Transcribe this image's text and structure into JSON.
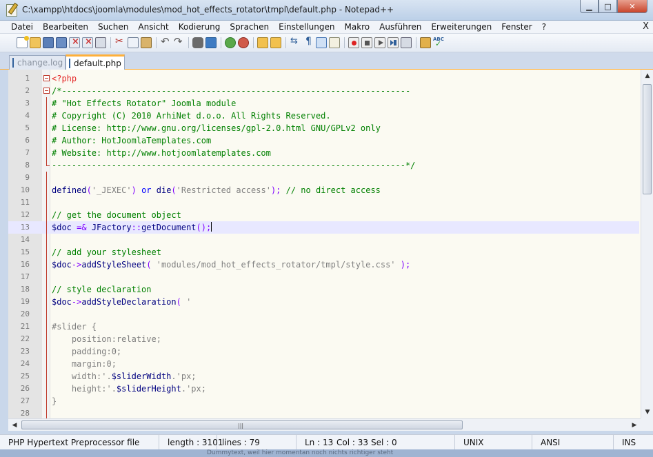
{
  "window": {
    "title": "C:\\xampp\\htdocs\\joomla\\modules\\mod_hot_effects_rotator\\tmpl\\default.php - Notepad++",
    "buttons": {
      "minimize": "▁",
      "maximize": "□",
      "close": "✕"
    }
  },
  "menu": {
    "items": [
      "Datei",
      "Bearbeiten",
      "Suchen",
      "Ansicht",
      "Kodierung",
      "Sprachen",
      "Einstellungen",
      "Makro",
      "Ausführen",
      "Erweiterungen",
      "Fenster",
      "?"
    ],
    "close_label": "X"
  },
  "tabs": [
    {
      "label": "change.log",
      "active": false
    },
    {
      "label": "default.php",
      "active": true
    }
  ],
  "editor": {
    "current_line": 13,
    "lines": [
      {
        "n": "1",
        "fold": "box",
        "segments": [
          {
            "t": "<?php",
            "c": "#e32727"
          }
        ]
      },
      {
        "n": "2",
        "fold": "box",
        "segments": [
          {
            "t": "/*----------------------------------------------------------------------",
            "c": "#008000"
          }
        ]
      },
      {
        "n": "3",
        "fold": "vline",
        "segments": [
          {
            "t": "# \"Hot Effects Rotator\" Joomla module",
            "c": "#008000"
          }
        ]
      },
      {
        "n": "4",
        "fold": "vline",
        "segments": [
          {
            "t": "# Copyright (C) 2010 ArhiNet d.o.o. All Rights Reserved.",
            "c": "#008000"
          }
        ]
      },
      {
        "n": "5",
        "fold": "vline",
        "segments": [
          {
            "t": "# License: http://www.gnu.org/licenses/gpl-2.0.html GNU/GPLv2 only",
            "c": "#008000"
          }
        ]
      },
      {
        "n": "6",
        "fold": "vline",
        "segments": [
          {
            "t": "# Author: HotJoomlaTemplates.com",
            "c": "#008000"
          }
        ]
      },
      {
        "n": "7",
        "fold": "vline",
        "segments": [
          {
            "t": "# Website: http://www.hotjoomlatemplates.com",
            "c": "#008000"
          }
        ]
      },
      {
        "n": "8",
        "fold": "end",
        "segments": [
          {
            "t": "-----------------------------------------------------------------------*/",
            "c": "#008000"
          }
        ]
      },
      {
        "n": "9",
        "fold": "vline",
        "segments": []
      },
      {
        "n": "10",
        "fold": "vline",
        "segments": [
          {
            "t": "defined",
            "c": "#000080"
          },
          {
            "t": "(",
            "c": "#8000ff"
          },
          {
            "t": "'_JEXEC'",
            "c": "#808080"
          },
          {
            "t": ") ",
            "c": "#8000ff"
          },
          {
            "t": "or",
            "c": "#0000ff"
          },
          {
            "t": " die",
            "c": "#000080"
          },
          {
            "t": "(",
            "c": "#8000ff"
          },
          {
            "t": "'Restricted access'",
            "c": "#808080"
          },
          {
            "t": "); ",
            "c": "#8000ff"
          },
          {
            "t": "// no direct access",
            "c": "#008000"
          }
        ]
      },
      {
        "n": "11",
        "fold": "vline",
        "segments": []
      },
      {
        "n": "12",
        "fold": "vline",
        "segments": [
          {
            "t": "// get the document object",
            "c": "#008000"
          }
        ]
      },
      {
        "n": "13",
        "fold": "vline",
        "segments": [
          {
            "t": "$doc",
            "c": "#000080"
          },
          {
            "t": " =& ",
            "c": "#8000ff"
          },
          {
            "t": "JFactory",
            "c": "#000080"
          },
          {
            "t": "::",
            "c": "#8000ff"
          },
          {
            "t": "getDocument",
            "c": "#000080"
          },
          {
            "t": "();",
            "c": "#8000ff"
          }
        ]
      },
      {
        "n": "14",
        "fold": "vline",
        "segments": []
      },
      {
        "n": "15",
        "fold": "vline",
        "segments": [
          {
            "t": "// add your stylesheet",
            "c": "#008000"
          }
        ]
      },
      {
        "n": "16",
        "fold": "vline",
        "segments": [
          {
            "t": "$doc",
            "c": "#000080"
          },
          {
            "t": "->",
            "c": "#8000ff"
          },
          {
            "t": "addStyleSheet",
            "c": "#000080"
          },
          {
            "t": "( ",
            "c": "#8000ff"
          },
          {
            "t": "'modules/mod_hot_effects_rotator/tmpl/style.css'",
            "c": "#808080"
          },
          {
            "t": " );",
            "c": "#8000ff"
          }
        ]
      },
      {
        "n": "17",
        "fold": "vline",
        "segments": []
      },
      {
        "n": "18",
        "fold": "vline",
        "segments": [
          {
            "t": "// style declaration",
            "c": "#008000"
          }
        ]
      },
      {
        "n": "19",
        "fold": "vline",
        "segments": [
          {
            "t": "$doc",
            "c": "#000080"
          },
          {
            "t": "->",
            "c": "#8000ff"
          },
          {
            "t": "addStyleDeclaration",
            "c": "#000080"
          },
          {
            "t": "( ",
            "c": "#8000ff"
          },
          {
            "t": "'",
            "c": "#808080"
          }
        ]
      },
      {
        "n": "20",
        "fold": "vline",
        "segments": []
      },
      {
        "n": "21",
        "fold": "vline",
        "segments": [
          {
            "t": "#slider {",
            "c": "#808080"
          }
        ]
      },
      {
        "n": "22",
        "fold": "vline",
        "segments": [
          {
            "t": "    position:relative;",
            "c": "#808080"
          }
        ]
      },
      {
        "n": "23",
        "fold": "vline",
        "segments": [
          {
            "t": "    padding:0;",
            "c": "#808080"
          }
        ]
      },
      {
        "n": "24",
        "fold": "vline",
        "segments": [
          {
            "t": "    margin:0;",
            "c": "#808080"
          }
        ]
      },
      {
        "n": "25",
        "fold": "vline",
        "segments": [
          {
            "t": "    width:'.",
            "c": "#808080"
          },
          {
            "t": "$sliderWidth",
            "c": "#000080"
          },
          {
            "t": ".'px;",
            "c": "#808080"
          }
        ]
      },
      {
        "n": "26",
        "fold": "vline",
        "segments": [
          {
            "t": "    height:'.",
            "c": "#808080"
          },
          {
            "t": "$sliderHeight",
            "c": "#000080"
          },
          {
            "t": ".'px;",
            "c": "#808080"
          }
        ]
      },
      {
        "n": "27",
        "fold": "vline",
        "segments": [
          {
            "t": "}",
            "c": "#808080"
          }
        ]
      },
      {
        "n": "28",
        "fold": "vline",
        "segments": []
      }
    ]
  },
  "statusbar": {
    "filetype": "PHP Hypertext Preprocessor file",
    "length": "length : 3101",
    "lines": "lines : 79",
    "ln": "Ln : 13",
    "col": "Col : 33",
    "sel": "Sel : 0",
    "eol": "UNIX",
    "encoding": "ANSI",
    "mode": "INS"
  },
  "background_text": "Dummytext, weil hier momentan noch nichts richtiger steht"
}
